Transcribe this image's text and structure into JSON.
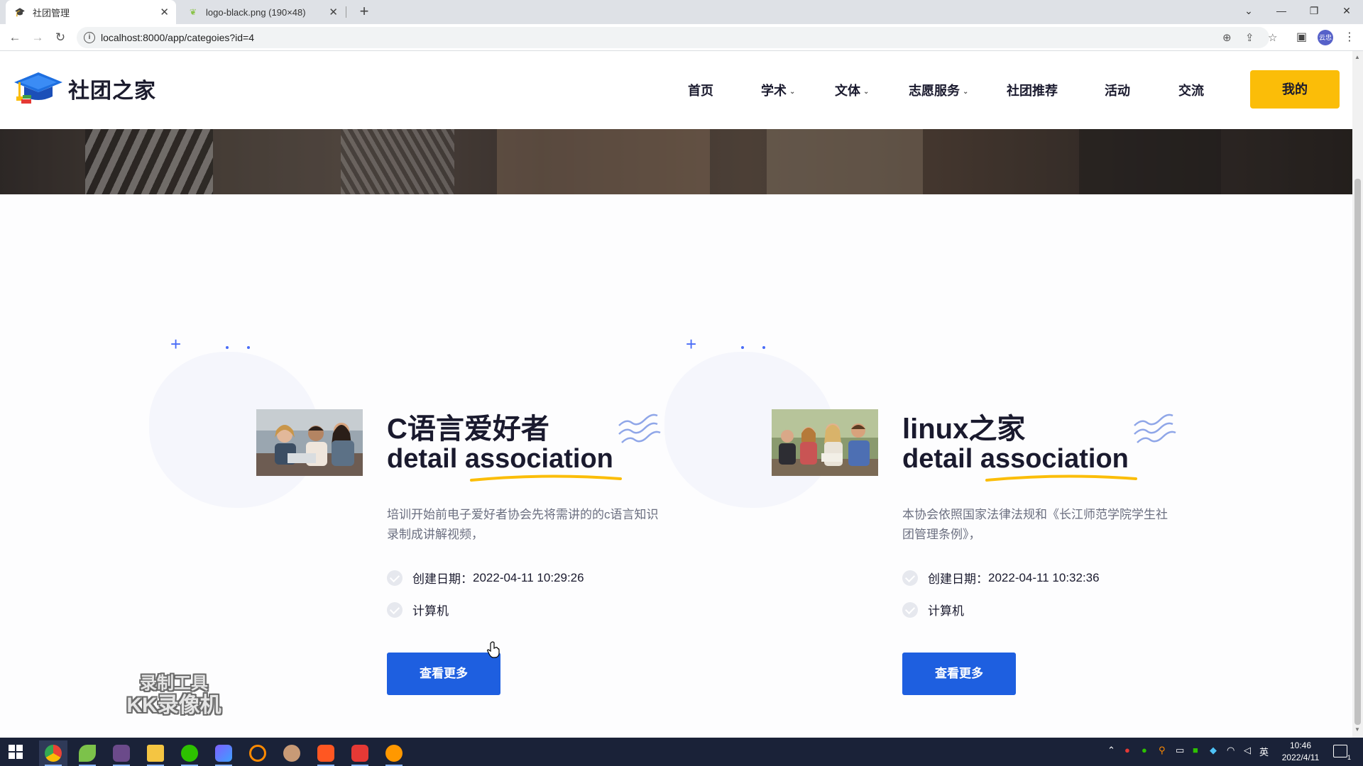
{
  "browser": {
    "tabs": [
      {
        "title": "社团管理",
        "active": true
      },
      {
        "title": "logo-black.png (190×48)",
        "active": false
      }
    ],
    "url": "localhost:8000/app/categoies?id=4",
    "profile_label": "云忠"
  },
  "site": {
    "logo_text": "社团之家",
    "menu": [
      {
        "label": "首页",
        "dropdown": false
      },
      {
        "label": "学术",
        "dropdown": true
      },
      {
        "label": "文体",
        "dropdown": true
      },
      {
        "label": "志愿服务",
        "dropdown": true
      },
      {
        "label": "社团推荐",
        "dropdown": false
      },
      {
        "label": "活动",
        "dropdown": false
      },
      {
        "label": "交流",
        "dropdown": false
      }
    ],
    "mine_label": "我的",
    "accent_color": "#fbbd08",
    "button_color": "#1e5fe0"
  },
  "cards": [
    {
      "title": "C语言爱好者",
      "subtitle_a": "detail",
      "subtitle_b": "association",
      "description": "培训开始前电子爱好者协会先将需讲的的c语言知识录制成讲解视频，",
      "created_label": "创建日期：",
      "created_value": "2022-04-11 10:29:26",
      "category": "计算机",
      "button": "查看更多"
    },
    {
      "title": "linux之家",
      "subtitle_a": "detail",
      "subtitle_b": "association",
      "description": "本协会依照国家法律法规和《长江师范学院学生社团管理条例》，",
      "created_label": "创建日期：",
      "created_value": "2022-04-11 10:32:36",
      "category": "计算机",
      "button": "查看更多"
    }
  ],
  "watermark": {
    "line1": "录制工具",
    "line2": "KK录像机"
  },
  "taskbar": {
    "ime": "英",
    "time": "10:46",
    "date": "2022/4/11",
    "notification_count": "1"
  }
}
